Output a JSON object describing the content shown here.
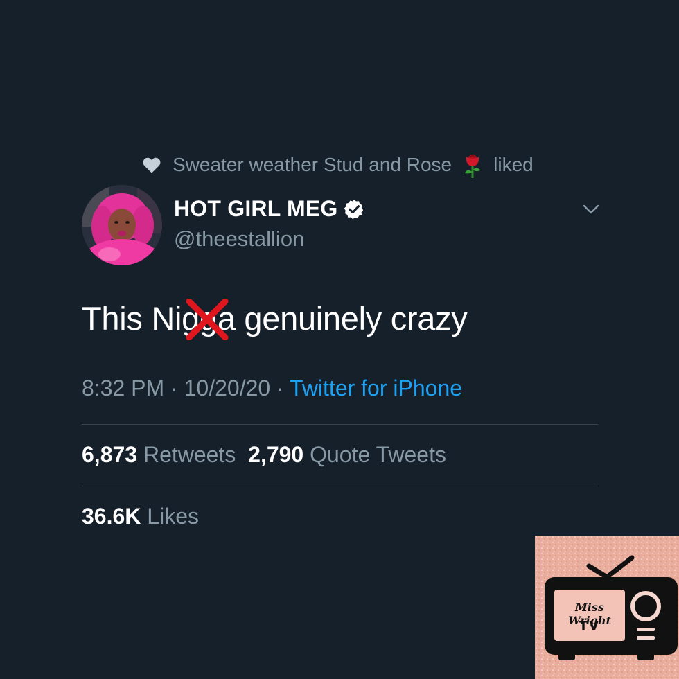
{
  "social_context": {
    "text": "Sweater weather Stud and Rose",
    "suffix": "liked",
    "heart_icon": "heart-icon",
    "rose_icon": "rose-emoji"
  },
  "author": {
    "display_name": "HOT GIRL MEG",
    "handle": "@theestallion",
    "verified": true,
    "verified_icon": "verified-badge-icon"
  },
  "tweet": {
    "text_before": "This N",
    "text_censored": "ig",
    "text_after": "ga genuinely crazy",
    "censor_icon": "red-x-mark"
  },
  "meta": {
    "time": "8:32 PM",
    "separator": " · ",
    "date": "10/20/20",
    "source": "Twitter for iPhone"
  },
  "stats": {
    "retweets_count": "6,873",
    "retweets_label": "Retweets",
    "quote_count": "2,790",
    "quote_label": "Quote Tweets",
    "likes_count": "36.6K",
    "likes_label": "Likes"
  },
  "watermark": {
    "line1": "Miss Wright",
    "line2": "TV",
    "icon": "retro-tv-logo"
  },
  "colors": {
    "background": "#15202b",
    "secondary_text": "#8899a6",
    "link": "#1da1f2",
    "divider": "#38444d",
    "censor_red": "#e0161e"
  }
}
